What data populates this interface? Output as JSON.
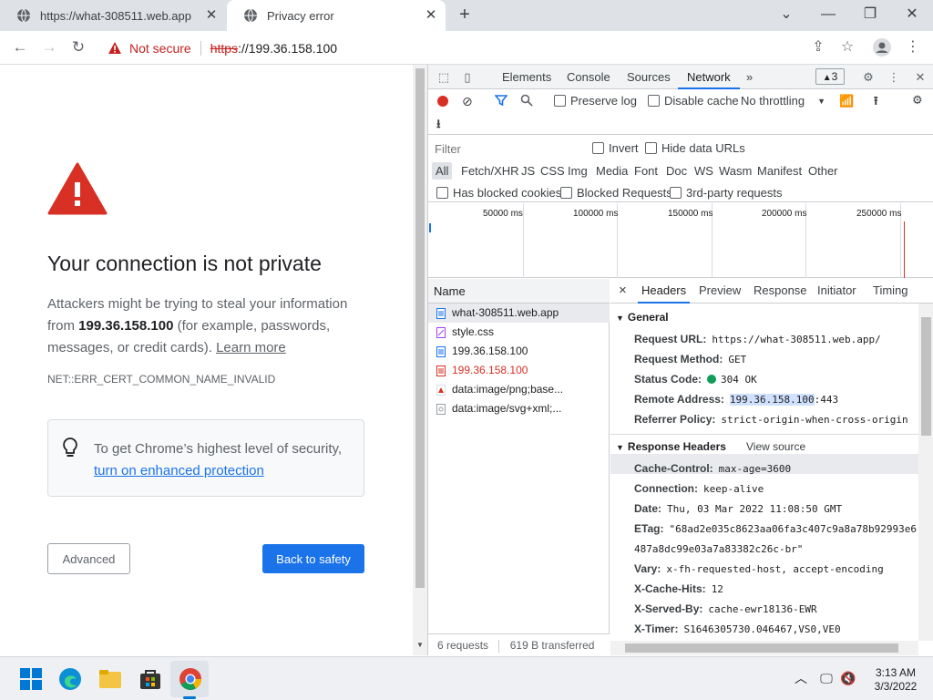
{
  "tabs": [
    {
      "title": "https://what-308511.web.app"
    },
    {
      "title": "Privacy error"
    }
  ],
  "toolbar": {
    "security_label": "Not secure",
    "url_scheme": "https",
    "url_rest": "://199.36.158.100"
  },
  "page": {
    "heading": "Your connection is not private",
    "explain_1": "Attackers might be trying to steal your information from ",
    "explain_host": "199.36.158.100",
    "explain_2": " (for example, passwords, messages, or credit cards). ",
    "learn_more": "Learn more",
    "error_code": "NET::ERR_CERT_COMMON_NAME_INVALID",
    "security_tip": "To get Chrome’s highest level of security, ",
    "security_link": "turn on enhanced protection",
    "advanced_label": "Advanced",
    "back_label": "Back to safety"
  },
  "devtools": {
    "tabs": [
      "Elements",
      "Console",
      "Sources",
      "Network"
    ],
    "more": "»",
    "issues_count": "3",
    "toolbar": {
      "preserve_log": "Preserve log",
      "disable_cache": "Disable cache",
      "throttling": "No throttling"
    },
    "filter": {
      "placeholder": "Filter",
      "invert": "Invert",
      "hide_data_urls": "Hide data URLs",
      "types": [
        "All",
        "Fetch/XHR",
        "JS",
        "CSS",
        "Img",
        "Media",
        "Font",
        "Doc",
        "WS",
        "Wasm",
        "Manifest",
        "Other"
      ],
      "has_blocked_cookies": "Has blocked cookies",
      "blocked_requests": "Blocked Requests",
      "third_party": "3rd-party requests"
    },
    "overview_ticks": [
      "50000 ms",
      "100000 ms",
      "150000 ms",
      "200000 ms",
      "250000 ms"
    ],
    "requests": {
      "name_header": "Name",
      "items": [
        {
          "name": "what-308511.web.app"
        },
        {
          "name": "style.css"
        },
        {
          "name": "199.36.158.100"
        },
        {
          "name": "199.36.158.100"
        },
        {
          "name": "data:image/png;base..."
        },
        {
          "name": "data:image/svg+xml;..."
        }
      ],
      "summary_requests": "6 requests",
      "summary_transferred": "619 B transferred"
    },
    "details": {
      "close": "×",
      "tabs": [
        "Headers",
        "Preview",
        "Response",
        "Initiator",
        "Timing"
      ],
      "general_title": "General",
      "general": [
        {
          "k": "Request URL:",
          "v": "https://what-308511.web.app/"
        },
        {
          "k": "Request Method:",
          "v": "GET"
        },
        {
          "k": "Status Code:",
          "v": "304 OK"
        },
        {
          "k": "Remote Address:",
          "v_hl": "199.36.158.100",
          "v": ":443"
        },
        {
          "k": "Referrer Policy:",
          "v": "strict-origin-when-cross-origin"
        }
      ],
      "response_title": "Response Headers",
      "view_source": "View source",
      "response": [
        {
          "k": "Cache-Control:",
          "v": "max-age=3600"
        },
        {
          "k": "Connection:",
          "v": "keep-alive"
        },
        {
          "k": "Date:",
          "v": "Thu, 03 Mar 2022 11:08:50 GMT"
        },
        {
          "k": "ETag:",
          "v": "\"68ad2e035c8623aa06fa3c407c9a8a78b92993e6"
        },
        {
          "k": "",
          "v": "487a8dc99e03a7a83382c26c-br\""
        },
        {
          "k": "Vary:",
          "v": "x-fh-requested-host, accept-encoding"
        },
        {
          "k": "X-Cache-Hits:",
          "v": "12"
        },
        {
          "k": "X-Served-By:",
          "v": "cache-ewr18136-EWR"
        },
        {
          "k": "X-Timer:",
          "v": "S1646305730.046467,VS0,VE0"
        }
      ]
    }
  },
  "taskbar": {
    "time": "3:13 AM",
    "date": "3/3/2022"
  },
  "colors": {
    "accent": "#1a73e8",
    "danger": "#d93025",
    "status_ok": "#0f9d58"
  }
}
